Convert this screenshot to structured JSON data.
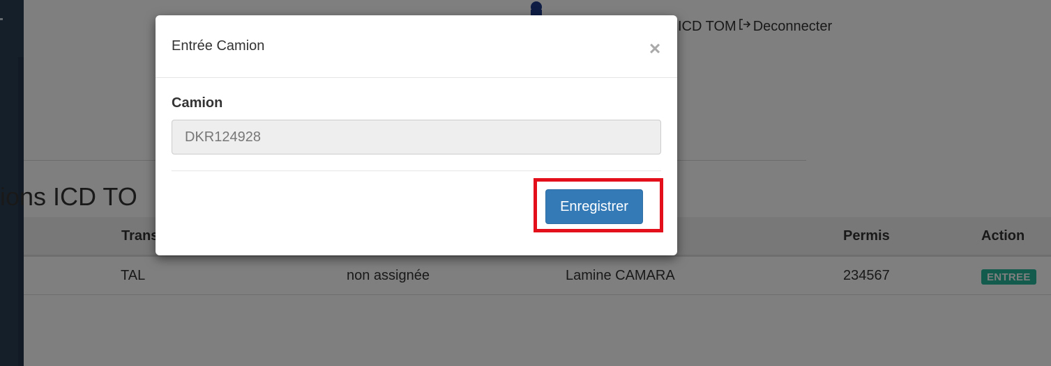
{
  "header": {
    "user_label": "ICD TOM",
    "logout_icon": "logout-icon",
    "logout_label": "Deconnecter"
  },
  "page": {
    "section_title": "ions ICD TO"
  },
  "table": {
    "columns": [
      "Trans",
      "Permis",
      "Action"
    ],
    "rows": [
      {
        "transporteur": "TAL",
        "assignation": "non assignée",
        "chauffeur": "Lamine CAMARA",
        "permis": "234567",
        "action": "ENTREE"
      }
    ]
  },
  "modal": {
    "title": "Entrée Camion",
    "close_icon": "close-icon",
    "close_label": "×",
    "field_label": "Camion",
    "field_value": "DKR124928",
    "save_label": "Enregistrer"
  },
  "colors": {
    "primary_button": "#337ab7",
    "badge": "#26b99a",
    "highlight": "#e3101b",
    "sidebar": "#2a3f54"
  }
}
